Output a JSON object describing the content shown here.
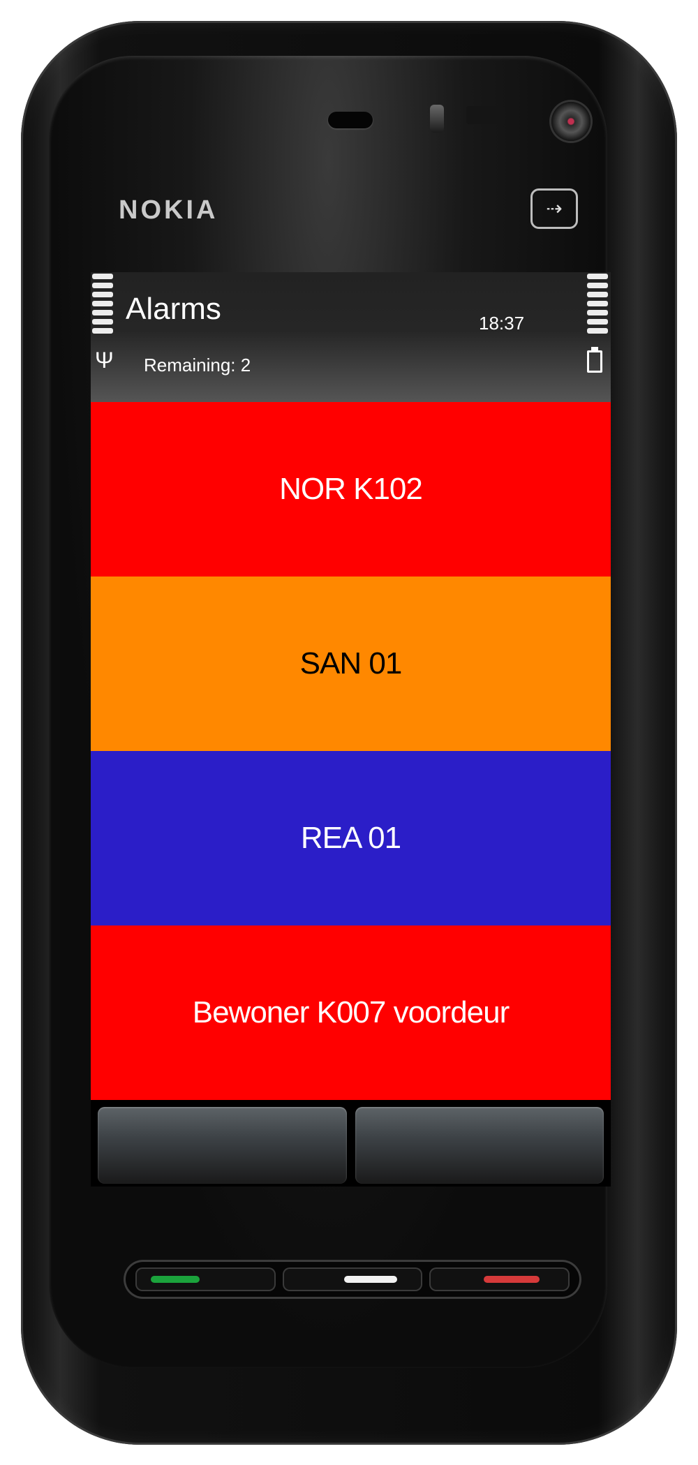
{
  "device": {
    "brand": "NOKIA",
    "menu_key_icon": "menu-arrow-icon"
  },
  "status_bar": {
    "app_title": "Alarms",
    "clock": "18:37",
    "remaining": "Remaining: 2",
    "signal_icon": "antenna-icon",
    "battery_icon": "battery-icon"
  },
  "alarms": [
    {
      "label": "NOR K102",
      "bg": "#ff0000",
      "fg": "#ffffff"
    },
    {
      "label": "SAN 01",
      "bg": "#ff8800",
      "fg": "#000000"
    },
    {
      "label": "REA 01",
      "bg": "#2b1ec8",
      "fg": "#ffffff"
    },
    {
      "label": "Bewoner K007 voordeur",
      "bg": "#ff0000",
      "fg": "#ffffff"
    }
  ],
  "softkeys": {
    "left_label": "",
    "right_label": ""
  },
  "hardware_keys": {
    "call_color": "#1ba33c",
    "menu_color": "#f2f2f2",
    "end_color": "#d63a3a"
  }
}
